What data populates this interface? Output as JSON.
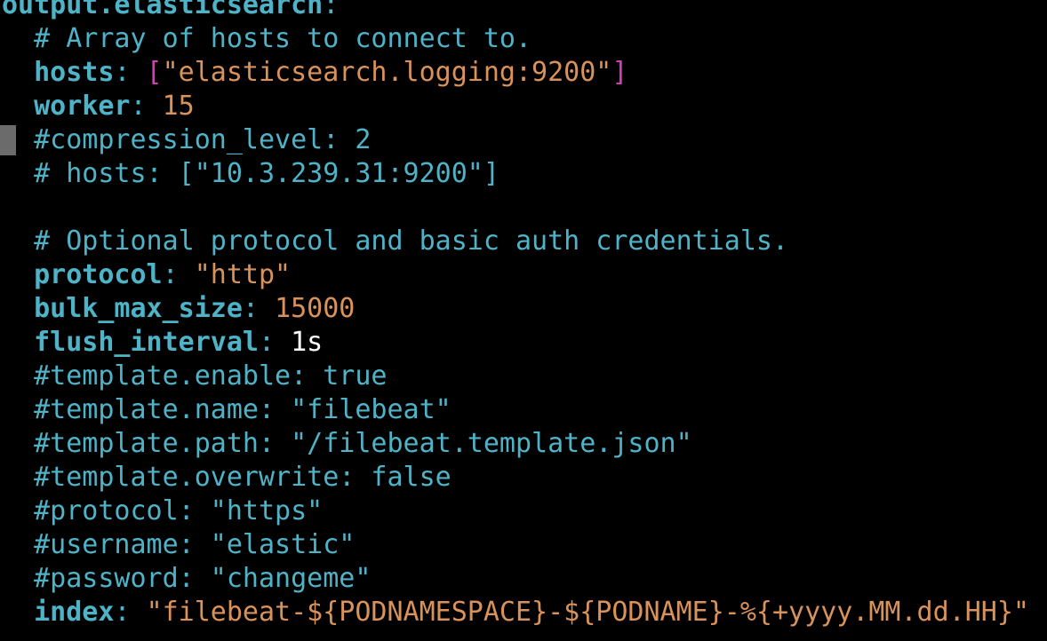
{
  "colors": {
    "background": "#000000",
    "key": "#4fb3c8",
    "comment": "#4fb3c8",
    "punct": "#4fb3c8",
    "string": "#d9925a",
    "number": "#d9925a",
    "bracket": "#d33fb5",
    "plain": "#ffffff",
    "cursor": "#6b6b6b"
  },
  "editor": {
    "lines": [
      [
        {
          "t": "output.elasticsearch",
          "c": "key",
          "b": true
        },
        {
          "t": ":",
          "c": "punct"
        }
      ],
      [
        {
          "t": "  # Array of hosts to connect to.",
          "c": "comment"
        }
      ],
      [
        {
          "t": "  ",
          "c": "plain"
        },
        {
          "t": "hosts",
          "c": "key",
          "b": true
        },
        {
          "t": ": ",
          "c": "punct"
        },
        {
          "t": "[",
          "c": "bracket"
        },
        {
          "t": "\"elasticsearch.logging:9200\"",
          "c": "string"
        },
        {
          "t": "]",
          "c": "bracket"
        }
      ],
      [
        {
          "t": "  ",
          "c": "plain"
        },
        {
          "t": "worker",
          "c": "key",
          "b": true
        },
        {
          "t": ": ",
          "c": "punct"
        },
        {
          "t": "15",
          "c": "number"
        }
      ],
      [
        {
          "t": "  #compression_level: 2",
          "c": "comment"
        }
      ],
      [
        {
          "t": "  # hosts: [\"10.3.239.31:9200\"]",
          "c": "comment"
        }
      ],
      [
        {
          "t": "",
          "c": "plain"
        }
      ],
      [
        {
          "t": "  # Optional protocol and basic auth credentials.",
          "c": "comment"
        }
      ],
      [
        {
          "t": "  ",
          "c": "plain"
        },
        {
          "t": "protocol",
          "c": "key",
          "b": true
        },
        {
          "t": ": ",
          "c": "punct"
        },
        {
          "t": "\"http\"",
          "c": "string"
        }
      ],
      [
        {
          "t": "  ",
          "c": "plain"
        },
        {
          "t": "bulk_max_size",
          "c": "key",
          "b": true
        },
        {
          "t": ": ",
          "c": "punct"
        },
        {
          "t": "15000",
          "c": "number"
        }
      ],
      [
        {
          "t": "  ",
          "c": "plain"
        },
        {
          "t": "flush_interval",
          "c": "key",
          "b": true
        },
        {
          "t": ": ",
          "c": "punct"
        },
        {
          "t": "1s",
          "c": "plain"
        }
      ],
      [
        {
          "t": "  #template.enable: true",
          "c": "comment"
        }
      ],
      [
        {
          "t": "  #template.name: \"filebeat\"",
          "c": "comment"
        }
      ],
      [
        {
          "t": "  #template.path: \"/filebeat.template.json\"",
          "c": "comment"
        }
      ],
      [
        {
          "t": "  #template.overwrite: false",
          "c": "comment"
        }
      ],
      [
        {
          "t": "  #protocol: \"https\"",
          "c": "comment"
        }
      ],
      [
        {
          "t": "  #username: \"elastic\"",
          "c": "comment"
        }
      ],
      [
        {
          "t": "  #password: \"changeme\"",
          "c": "comment"
        }
      ],
      [
        {
          "t": "  ",
          "c": "plain"
        },
        {
          "t": "index",
          "c": "key",
          "b": true
        },
        {
          "t": ": ",
          "c": "punct"
        },
        {
          "t": "\"filebeat-${PODNAMESPACE}-${PODNAME}-%{+yyyy.MM.dd.HH}\"",
          "c": "string"
        }
      ]
    ]
  }
}
